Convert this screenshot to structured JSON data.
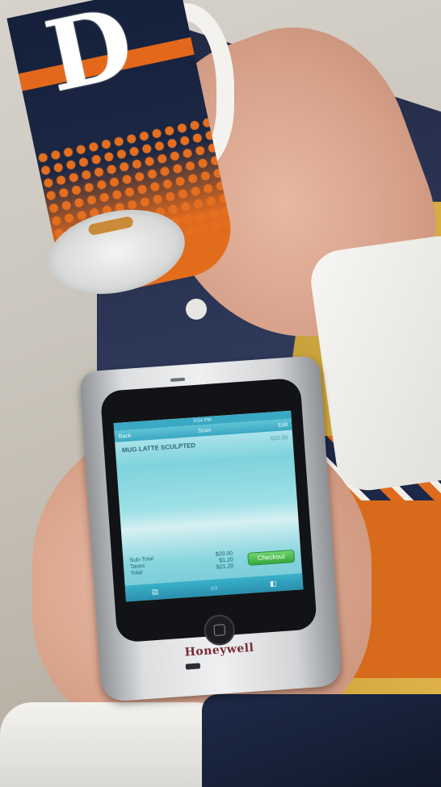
{
  "scene": {
    "description_objects": [
      "mug-icon",
      "hand",
      "mobile-computer"
    ]
  },
  "device": {
    "brand": "Honeywell",
    "status_time": "9:54 PM",
    "nav_title": "Scan",
    "nav_left": "Back",
    "nav_right": "Edit",
    "item_name": "MUG LATTE SCULPTED",
    "item_price": "$20.00",
    "totals": [
      {
        "label": "Sub-Total",
        "value": "$20.00"
      },
      {
        "label": "Taxes",
        "value": "$1.20"
      },
      {
        "label": "Total",
        "value": "$21.20"
      }
    ],
    "checkout_label": "Checkout",
    "tab_icons": [
      "cart-icon",
      "receipt-icon",
      "more-icon"
    ]
  },
  "colors": {
    "screen_accent": "#3aa9c4",
    "checkout_green": "#35a83c",
    "brand_red": "#7a2a33",
    "tigers_orange": "#e3681b",
    "tigers_navy": "#15203a"
  }
}
